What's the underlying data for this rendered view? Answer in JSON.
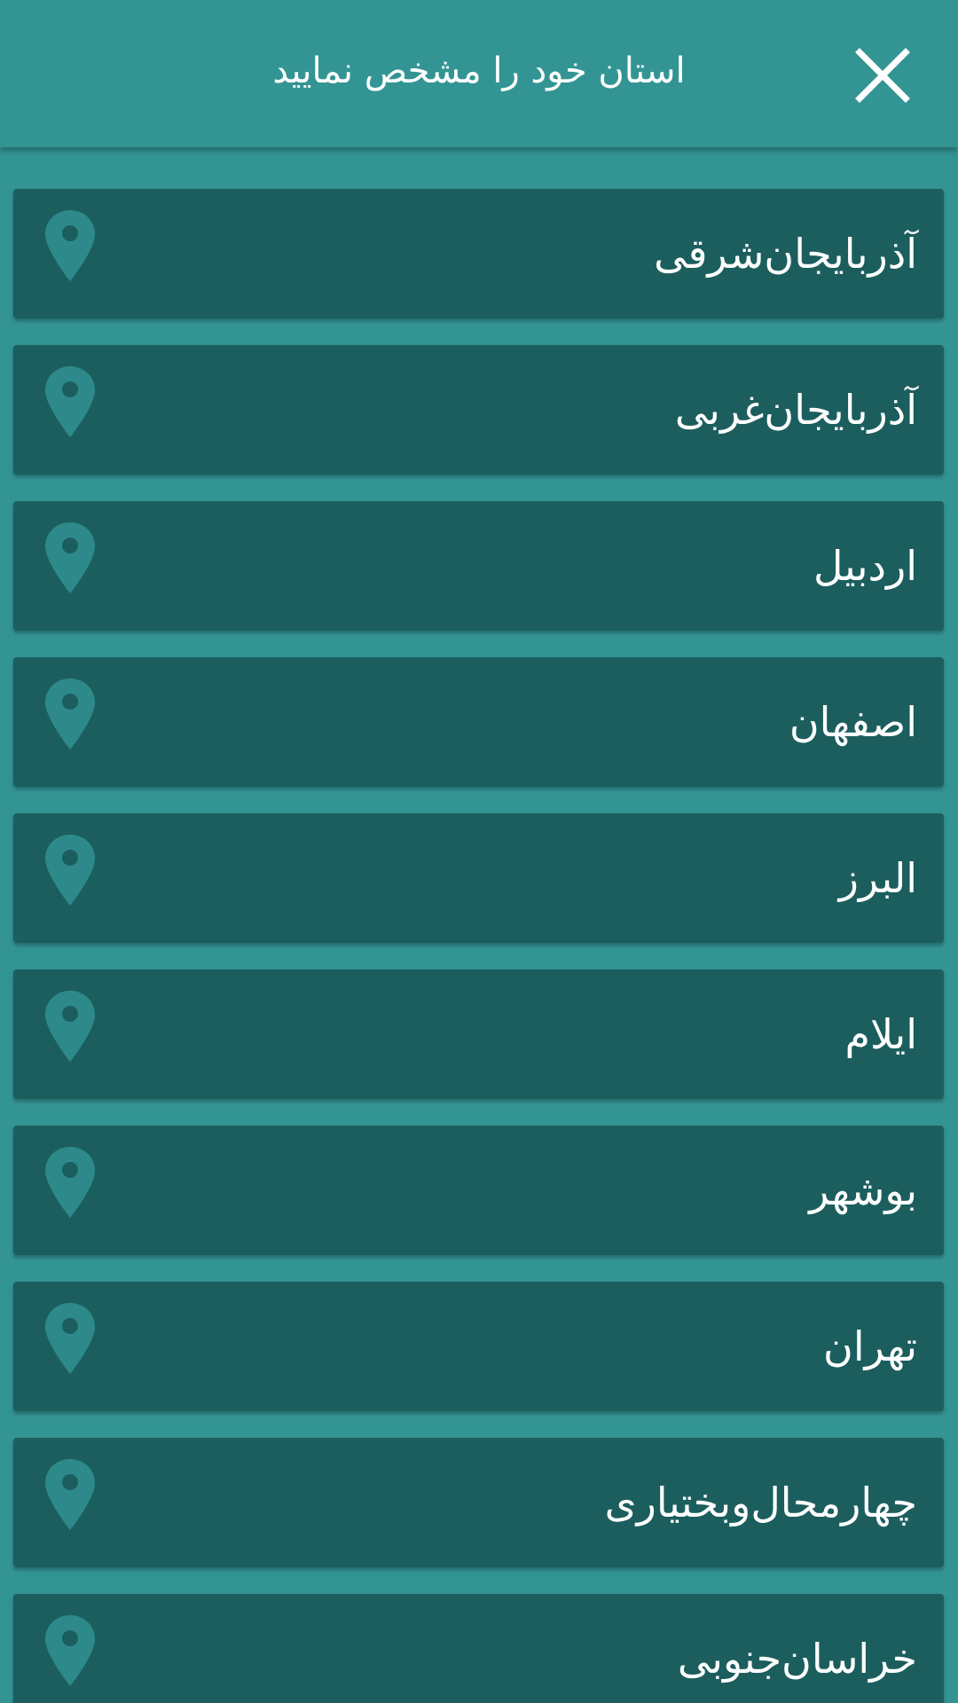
{
  "header": {
    "title": "استان خود را مشخص نمایید",
    "close_icon": "close-icon"
  },
  "colors": {
    "background": "#339494",
    "item_background": "#1c5e5e",
    "pin_color": "#2e8a8a",
    "text": "#ffffff"
  },
  "provinces": [
    {
      "label": "آذربایجان‌شرقی",
      "icon": "map-pin-icon"
    },
    {
      "label": "آذربایجان‌غربی",
      "icon": "map-pin-icon"
    },
    {
      "label": "اردبیل",
      "icon": "map-pin-icon"
    },
    {
      "label": "اصفهان",
      "icon": "map-pin-icon"
    },
    {
      "label": "البرز",
      "icon": "map-pin-icon"
    },
    {
      "label": "ایلام",
      "icon": "map-pin-icon"
    },
    {
      "label": "بوشهر",
      "icon": "map-pin-icon"
    },
    {
      "label": "تهران",
      "icon": "map-pin-icon"
    },
    {
      "label": "چهارمحال‌وبختیاری",
      "icon": "map-pin-icon"
    },
    {
      "label": "خراسان‌جنوبی",
      "icon": "map-pin-icon"
    }
  ]
}
